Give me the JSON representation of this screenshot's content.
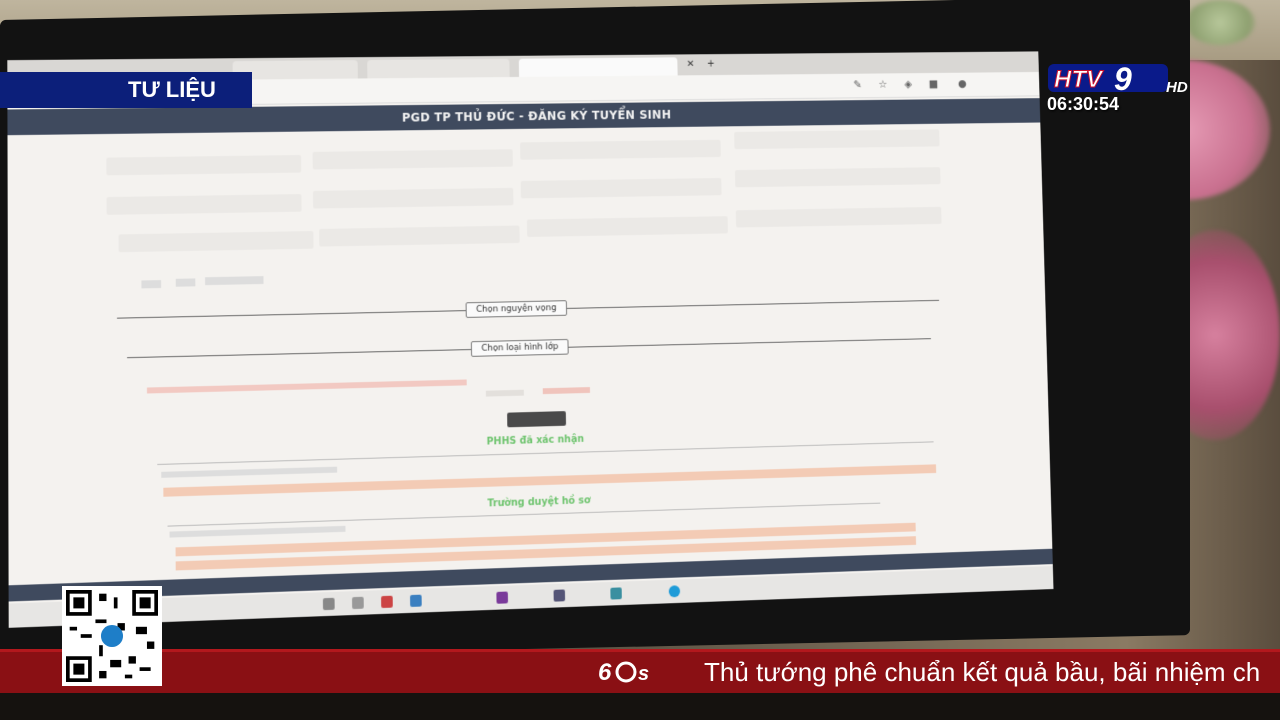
{
  "overlay": {
    "segment_label": "TƯ LIỆU",
    "channel_logo": "HTV9HD",
    "clock": "06:30:54",
    "ticker_text": "Thủ tướng phê chuẩn kết quả bầu, bãi nhiệm ch",
    "ticker_logo": "60s"
  },
  "screen": {
    "site_title": "PGD TP THỦ ĐỨC - ĐĂNG KÝ TUYỂN SINH",
    "buttons": {
      "choose_wish": "Chọn nguyện vọng",
      "choose_class": "Chọn loại hình lớp"
    },
    "status": {
      "parent_confirmed": "PHHS đã xác nhận",
      "school_review": "Trường duyệt hồ sơ"
    }
  },
  "colors": {
    "label_bg": "#0c1f7a",
    "ticker_bg": "#8a1014",
    "site_header_bg": "#3f4a5e",
    "status_green": "#6fc46f"
  }
}
